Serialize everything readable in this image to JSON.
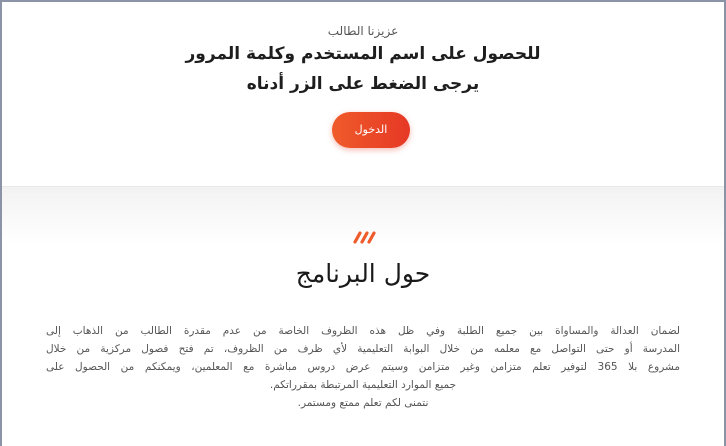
{
  "login_card": {
    "greeting": "عزيزنا الطالب",
    "instruction_line1": "للحصول على اسم المستخدم وكلمة المرور",
    "instruction_line2": "يرجى الضغط على الزر أدناه",
    "login_button_label": "الدخول"
  },
  "about": {
    "decor_icon": "triple-slash-accent-icon",
    "title": "حول البرنامج",
    "description_lines": [
      "لضمان العدالة والمساواة بين جميع الطلبة وفي ظل هذه الظروف الخاصة من عدم مقدرة الطالب من الذهاب إلى",
      "المدرسة أو حتى التواصل مع معلمه من خلال البوابة التعليمية لأي ظرف من الظروف، تم فتح فصول مركزية من خلال",
      "مشروع بلا 365 لتوفير تعلم متزامن وغير متزامن وسيتم عرض دروس مباشرة مع المعلمين، ويمكنكم من الحصول على",
      "جميع الموارد التعليمية المرتبطة بمقرراتكم."
    ],
    "closing": "نتمنى لكم تعلم ممتع ومستمر."
  },
  "colors": {
    "accent": "#ef5b2a",
    "button_gradient_end": "#e63826",
    "frame_border": "#8a94a6"
  }
}
